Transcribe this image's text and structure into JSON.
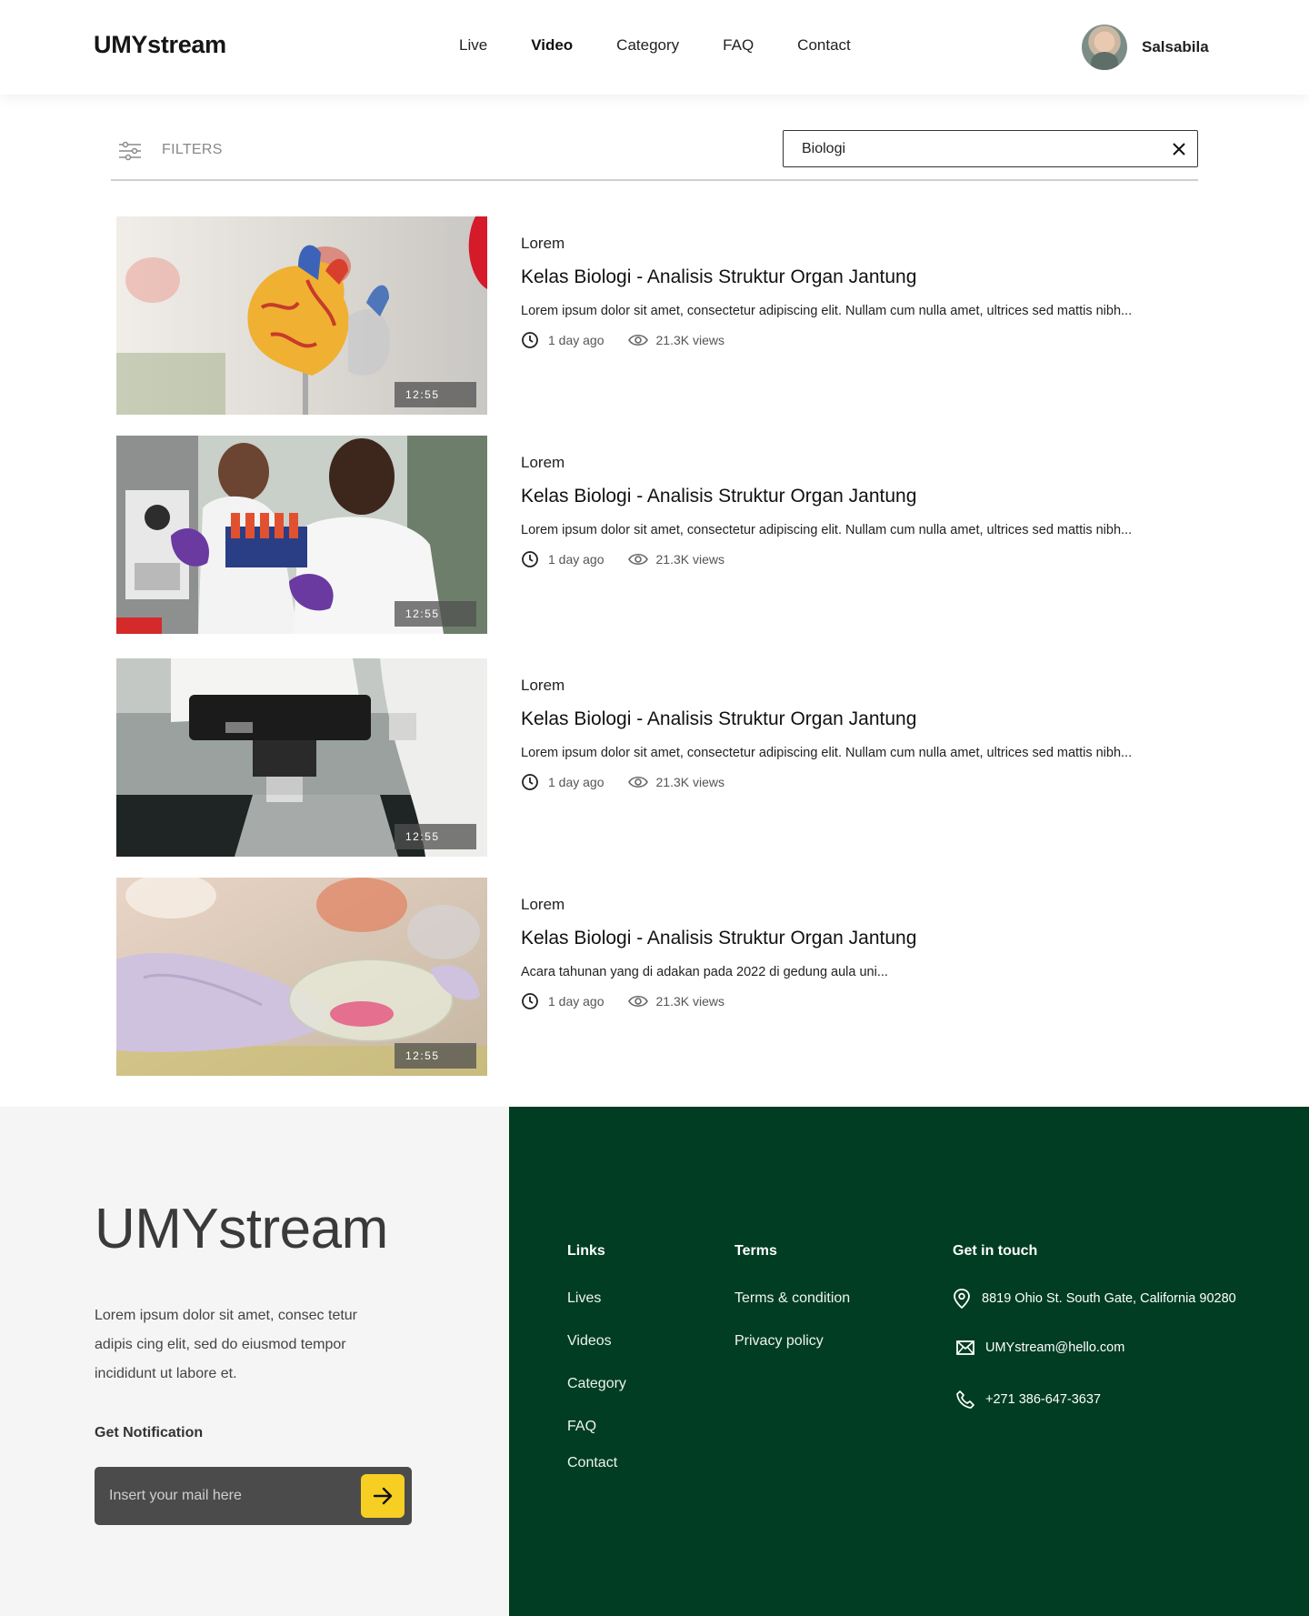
{
  "header": {
    "logo": "UMYstream",
    "nav": [
      "Live",
      "Video",
      "Category",
      "FAQ",
      "Contact"
    ],
    "active_nav": "Video",
    "user_name": "Salsabila"
  },
  "filters": {
    "label": "FILTERS",
    "search_value": "Biologi"
  },
  "results": [
    {
      "category": "Lorem",
      "title": "Kelas Biologi - Analisis Struktur Organ Jantung",
      "description": "Lorem ipsum dolor sit amet, consectetur adipiscing elit. Nullam cum nulla amet, ultrices sed mattis nibh...",
      "time": "1 day ago",
      "views": "21.3K views",
      "duration": "12:55",
      "thumb": "heart-model"
    },
    {
      "category": "Lorem",
      "title": "Kelas Biologi - Analisis Struktur Organ Jantung",
      "description": "Lorem ipsum dolor sit amet, consectetur adipiscing elit. Nullam cum nulla amet, ultrices sed mattis nibh...",
      "time": "1 day ago",
      "views": "21.3K views",
      "duration": "12:55",
      "thumb": "lab-scientists"
    },
    {
      "category": "Lorem",
      "title": "Kelas Biologi - Analisis Struktur Organ Jantung",
      "description": "Lorem ipsum dolor sit amet, consectetur adipiscing elit. Nullam cum nulla amet, ultrices sed mattis nibh...",
      "time": "1 day ago",
      "views": "21.3K views",
      "duration": "12:55",
      "thumb": "microscope"
    },
    {
      "category": "Lorem",
      "title": "Kelas Biologi - Analisis Struktur Organ Jantung",
      "description": "Acara tahunan yang di adakan pada 2022 di gedung aula uni...",
      "time": "1 day ago",
      "views": "21.3K views",
      "duration": "12:55",
      "thumb": "petri-dish"
    }
  ],
  "footer": {
    "logo": "UMYstream",
    "about": "Lorem ipsum dolor sit amet, consec tetur adipis cing elit, sed do eiusmod tempor incididunt ut labore et.",
    "notification_title": "Get Notification",
    "mail_placeholder": "Insert your mail here",
    "links_title": "Links",
    "links": [
      "Lives",
      "Videos",
      "Category",
      "FAQ",
      "Contact"
    ],
    "terms_title": "Terms",
    "terms": [
      "Terms & condition",
      "Privacy policy"
    ],
    "touch_title": "Get in touch",
    "address": "8819 Ohio St. South Gate, California 90280",
    "email": "UMYstream@hello.com",
    "phone": "+271 386-647-3637",
    "colors": {
      "footer_green": "#003d23",
      "accent_yellow": "#f7cf23"
    }
  }
}
